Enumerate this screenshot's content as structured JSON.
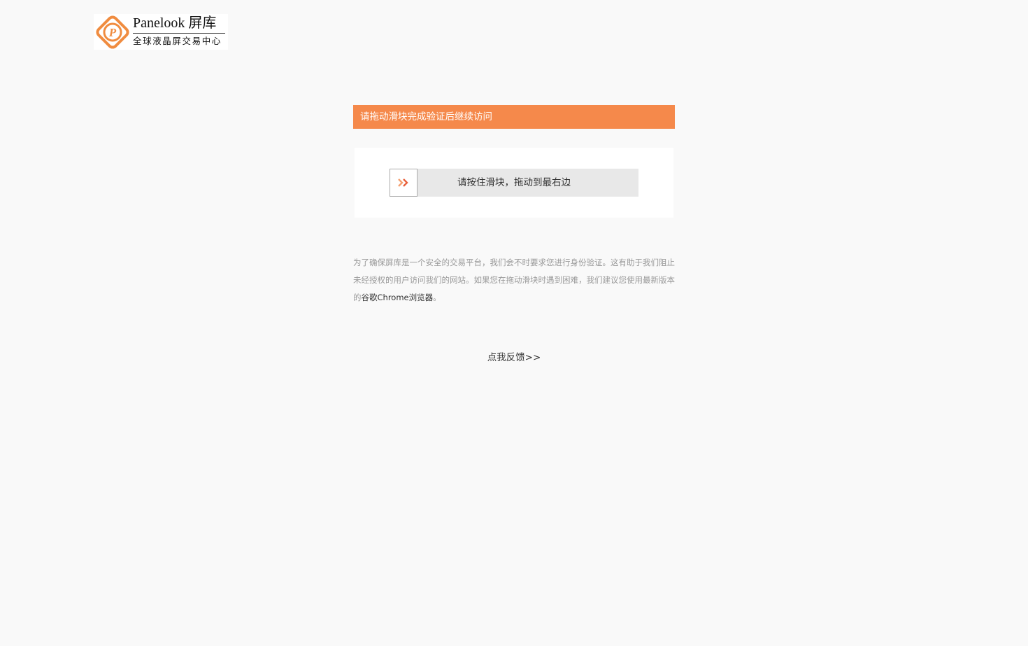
{
  "header": {
    "logo_title": "Panelook 屏库",
    "logo_subtitle": "全球液晶屏交易中心",
    "logo_color": "#f08c40"
  },
  "verify": {
    "banner_text": "请拖动滑块完成验证后继续访问",
    "banner_color": "#f5894b",
    "slider_hint": "请按住滑块，拖动到最右边",
    "slider_progress": 0,
    "handle_icon": "double-chevron-right-icon"
  },
  "info": {
    "text_before": "为了确保屏库是一个安全的交易平台，我们会不时要求您进行身份验证。这有助于我们阻止未经授权的用户访问我们的网站。如果您在拖动滑块时遇到困难，我们建议您使用最新版本的",
    "browser_link": "谷歌Chrome浏览器",
    "text_after": "。"
  },
  "feedback": {
    "label": "点我反馈>>"
  }
}
